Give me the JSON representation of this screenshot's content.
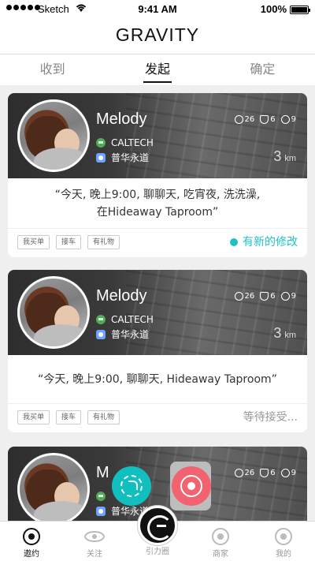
{
  "statusbar": {
    "carrier": "Sketch",
    "time": "9:41 AM",
    "battery": "100%"
  },
  "header": {
    "title": "GRAVITY"
  },
  "tabs": [
    {
      "label": "收到",
      "active": false
    },
    {
      "label": "发起",
      "active": true
    },
    {
      "label": "确定",
      "active": false
    }
  ],
  "cards": [
    {
      "name": "Melody",
      "school": "CALTECH",
      "location": "普华永道",
      "stats": [
        "26",
        "6",
        "9"
      ],
      "distance": "3",
      "distance_unit": "km",
      "message_line1": "“今天, 晚上9:00, 聊聊天, 吃宵夜, 洗洗澡,",
      "message_line2": "在Hideaway Taproom”",
      "chips": [
        "我买单",
        "接车",
        "有礼物"
      ],
      "status": "有新的修改",
      "status_color": "#1ec2c4"
    },
    {
      "name": "Melody",
      "school": "CALTECH",
      "location": "普华永道",
      "stats": [
        "26",
        "6",
        "9"
      ],
      "distance": "3",
      "distance_unit": "km",
      "message_line1": "“今天, 晚上9:00, 聊聊天, Hideaway Taproom”",
      "chips": [
        "我买单",
        "接车",
        "有礼物"
      ],
      "status": "等待接受..."
    },
    {
      "name": "M",
      "location": "普华永道",
      "stats": [
        "26",
        "6",
        "9"
      ]
    }
  ],
  "tabbar": [
    {
      "label": "遨约",
      "icon": "target-icon",
      "active": true
    },
    {
      "label": "关注",
      "icon": "eye-icon",
      "active": false
    },
    {
      "label": "引力圈",
      "icon": "gravity-logo-icon",
      "active": false
    },
    {
      "label": "商家",
      "icon": "shop-icon",
      "active": false
    },
    {
      "label": "我的",
      "icon": "profile-icon",
      "active": false
    }
  ]
}
